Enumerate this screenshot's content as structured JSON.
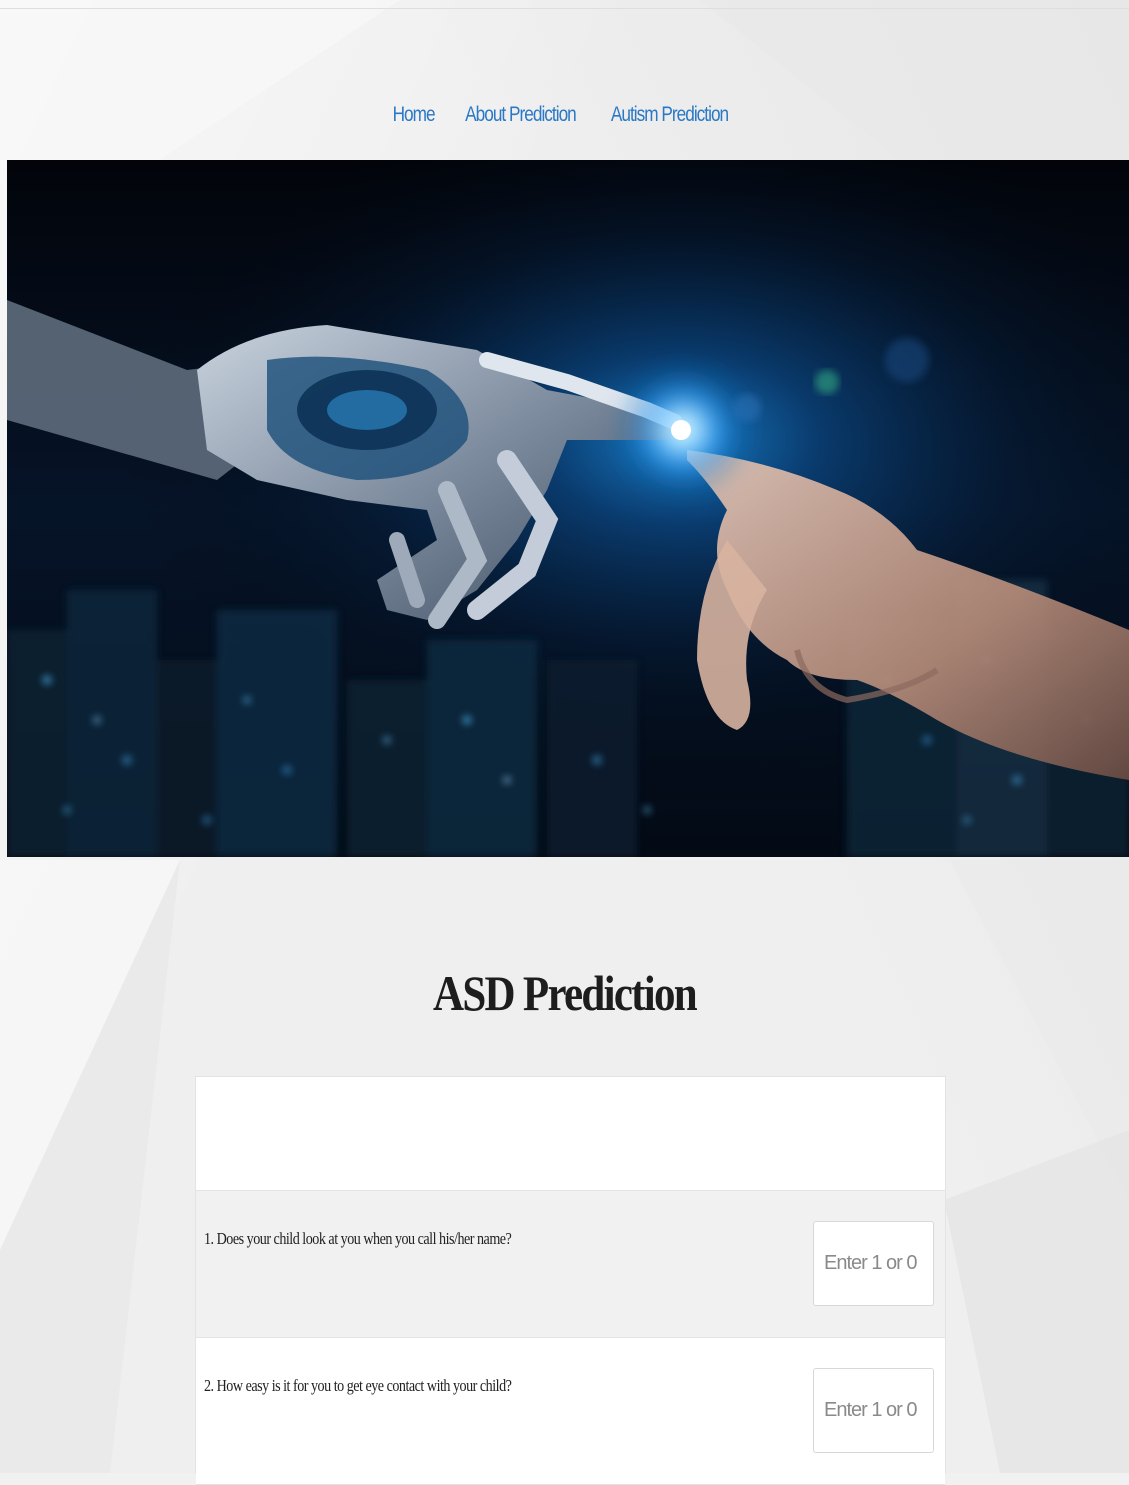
{
  "nav": {
    "items": [
      {
        "label": "Home"
      },
      {
        "label": "About Prediction"
      },
      {
        "label": "Autism Prediction"
      }
    ],
    "link_color": "#2b78c5"
  },
  "hero": {
    "image": "robot-hand-touching-human-hand-over-night-city"
  },
  "main": {
    "title": "ASD Prediction"
  },
  "form": {
    "questions": [
      {
        "text": "1. Does your child look at you when you call his/her name?",
        "placeholder": "Enter 1 or 0",
        "value": ""
      },
      {
        "text": "2. How easy is it for you to get eye contact with your child?",
        "placeholder": "Enter 1 or 0",
        "value": ""
      }
    ]
  }
}
